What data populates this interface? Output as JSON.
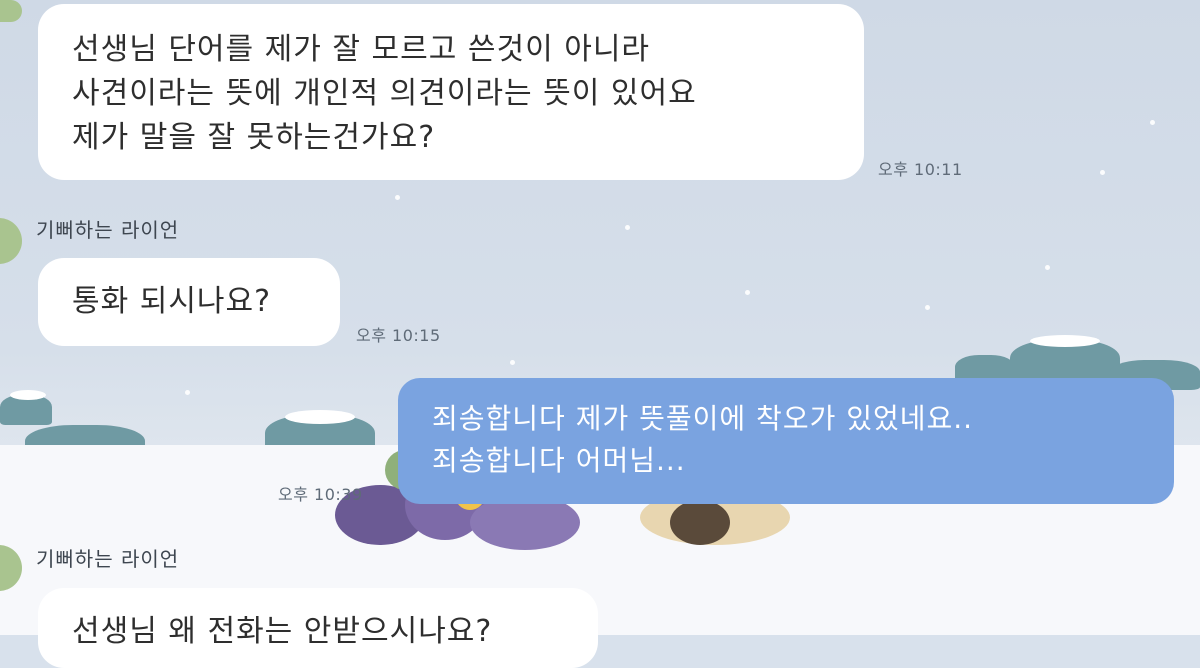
{
  "chat": {
    "messages": [
      {
        "sender": "",
        "lines": [
          "선생님 단어를 제가 잘 모르고 쓴것이 아니라",
          "사견이라는 뜻에 개인적 의견이라는 뜻이 있어요",
          "제가 말을 잘 못하는건가요?"
        ],
        "time": "오후 10:11"
      },
      {
        "sender": "기뻐하는 라이언",
        "lines": [
          "통화 되시나요?"
        ],
        "time": "오후 10:15"
      },
      {
        "sender": "me",
        "lines": [
          "죄송합니다 제가 뜻풀이에 착오가 있었네요..",
          "죄송합니다 어머님..."
        ],
        "time": "오후 10:39"
      },
      {
        "sender": "기뻐하는 라이언",
        "lines": [
          "선생님 왜 전화는 안받으시나요?"
        ],
        "time": ""
      }
    ]
  },
  "theme": {
    "bubble_incoming": "#ffffff",
    "bubble_outgoing": "#7aa3e0",
    "background": "#d8e1ec",
    "snow": "#f7f8fb",
    "trees": "#6f9aa3"
  }
}
